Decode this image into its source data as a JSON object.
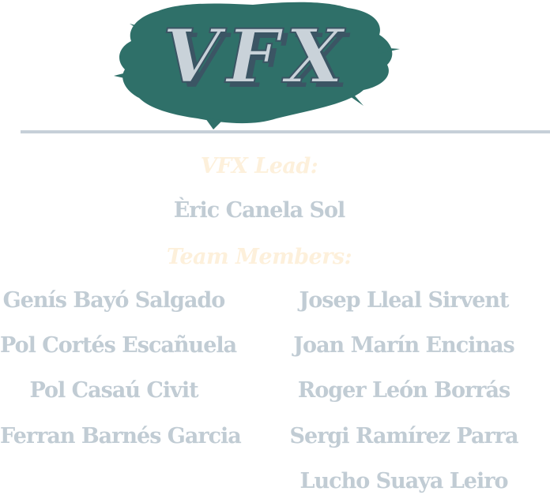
{
  "logo": {
    "text": "VFX",
    "splash_color": "#2f7069",
    "letter_color": "#c9d2d9",
    "shadow_color": "#3b5564"
  },
  "credits": {
    "lead_label": "VFX Lead:",
    "lead_name": "Èric Canela Sol",
    "members_label": "Team Members:",
    "members_left": [
      "Genís Bayó Salgado",
      "Pol Cortés Escañuela",
      "Pol Casaú Civit",
      "Ferran Barnés Garcia"
    ],
    "members_right": [
      "Josep Lleal Sirvent",
      "Joan Marín Encinas",
      "Roger León Borrás",
      "Sergi Ramírez Parra",
      "Lucho Suaya Leiro"
    ]
  },
  "colors": {
    "label": "#fdf0db",
    "name": "#c1ccd4",
    "divider": "#c6d0d8"
  }
}
